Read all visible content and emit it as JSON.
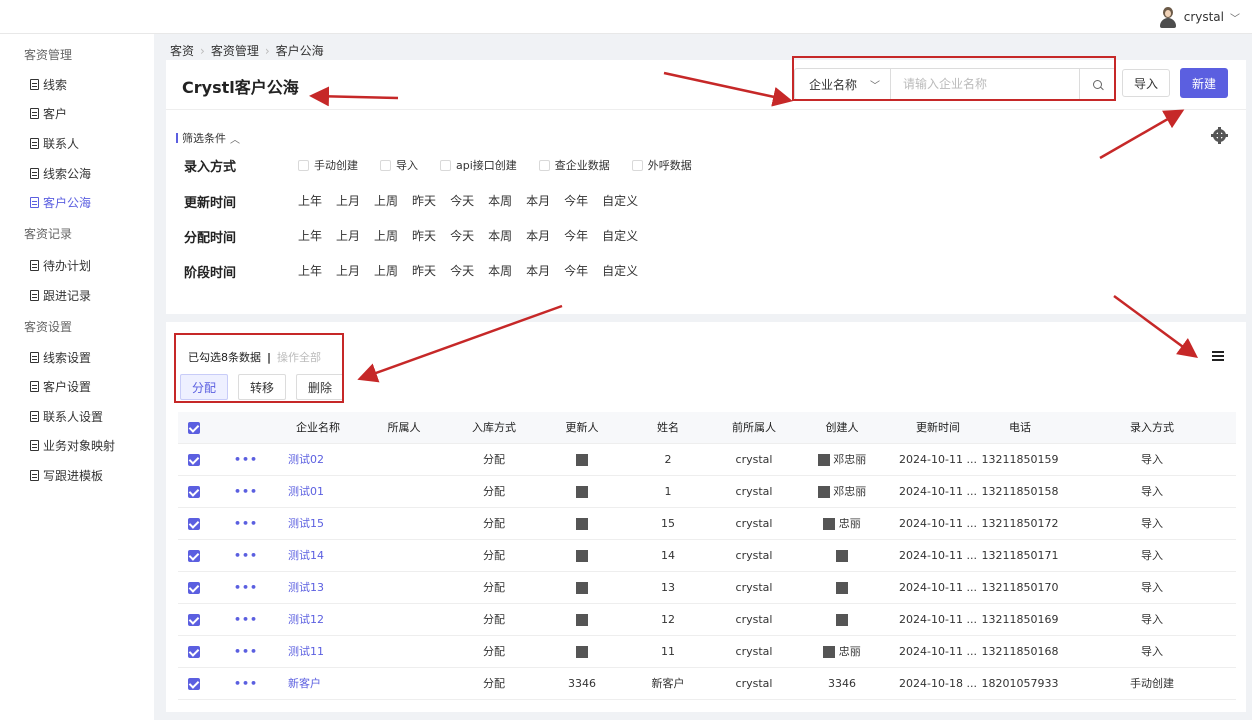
{
  "user": {
    "name": "crystal"
  },
  "sidebar": {
    "groups": [
      {
        "title": "客资管理",
        "items": [
          "线索",
          "客户",
          "联系人",
          "线索公海",
          "客户公海"
        ]
      },
      {
        "title": "客资记录",
        "items": [
          "待办计划",
          "跟进记录"
        ]
      },
      {
        "title": "客资设置",
        "items": [
          "线索设置",
          "客户设置",
          "联系人设置",
          "业务对象映射",
          "写跟进模板"
        ]
      }
    ],
    "active": "客户公海"
  },
  "breadcrumb": [
    "客资",
    "客资管理",
    "客户公海"
  ],
  "header": {
    "title": "Crystl客户公海",
    "search_field": "企业名称",
    "search_placeholder": "请输入企业名称",
    "import_label": "导入",
    "new_label": "新建"
  },
  "filters": {
    "head": "筛选条件",
    "rows": [
      {
        "label": "录入方式",
        "options": [
          "手动创建",
          "导入",
          "api接口创建",
          "查企业数据",
          "外呼数据"
        ]
      },
      {
        "label": "更新时间",
        "options": [
          "上年",
          "上月",
          "上周",
          "昨天",
          "今天",
          "本周",
          "本月",
          "今年",
          "自定义"
        ]
      },
      {
        "label": "分配时间",
        "options": [
          "上年",
          "上月",
          "上周",
          "昨天",
          "今天",
          "本周",
          "本月",
          "今年",
          "自定义"
        ]
      },
      {
        "label": "阶段时间",
        "options": [
          "上年",
          "上月",
          "上周",
          "昨天",
          "今天",
          "本周",
          "本月",
          "今年",
          "自定义"
        ]
      }
    ]
  },
  "selection": {
    "info": "已勾选8条数据",
    "pipe": "|",
    "all": "操作全部",
    "actions": [
      "分配",
      "转移",
      "删除"
    ]
  },
  "table": {
    "columns": [
      "企业名称",
      "所属人",
      "入库方式",
      "更新人",
      "姓名",
      "前所属人",
      "创建人",
      "更新时间",
      "电话",
      "录入方式"
    ],
    "rows": [
      {
        "company": "测试02",
        "owner": "",
        "method": "分配",
        "updater": "",
        "name": "2",
        "prev": "crystal",
        "creator": "邓忠丽",
        "time": "2024-10-11 ...",
        "phone": "13211850159",
        "entry": "导入"
      },
      {
        "company": "测试01",
        "owner": "",
        "method": "分配",
        "updater": "",
        "name": "1",
        "prev": "crystal",
        "creator": "邓忠丽",
        "time": "2024-10-11 ...",
        "phone": "13211850158",
        "entry": "导入"
      },
      {
        "company": "测试15",
        "owner": "",
        "method": "分配",
        "updater": "",
        "name": "15",
        "prev": "crystal",
        "creator": "忠丽",
        "time": "2024-10-11 ...",
        "phone": "13211850172",
        "entry": "导入"
      },
      {
        "company": "测试14",
        "owner": "",
        "method": "分配",
        "updater": "",
        "name": "14",
        "prev": "crystal",
        "creator": "",
        "time": "2024-10-11 ...",
        "phone": "13211850171",
        "entry": "导入"
      },
      {
        "company": "测试13",
        "owner": "",
        "method": "分配",
        "updater": "",
        "name": "13",
        "prev": "crystal",
        "creator": "",
        "time": "2024-10-11 ...",
        "phone": "13211850170",
        "entry": "导入"
      },
      {
        "company": "测试12",
        "owner": "",
        "method": "分配",
        "updater": "",
        "name": "12",
        "prev": "crystal",
        "creator": "",
        "time": "2024-10-11 ...",
        "phone": "13211850169",
        "entry": "导入"
      },
      {
        "company": "测试11",
        "owner": "",
        "method": "分配",
        "updater": "",
        "name": "11",
        "prev": "crystal",
        "creator": "忠丽",
        "time": "2024-10-11 ...",
        "phone": "13211850168",
        "entry": "导入"
      },
      {
        "company": "新客户",
        "owner": "",
        "method": "分配",
        "updater": "3346",
        "name": "新客户",
        "prev": "crystal",
        "creator": "3346",
        "time": "2024-10-18 ...",
        "phone": "18201057933",
        "entry": "手动创建"
      }
    ]
  },
  "colors": {
    "accent": "#5b5fe0",
    "annotation": "#c62828"
  }
}
